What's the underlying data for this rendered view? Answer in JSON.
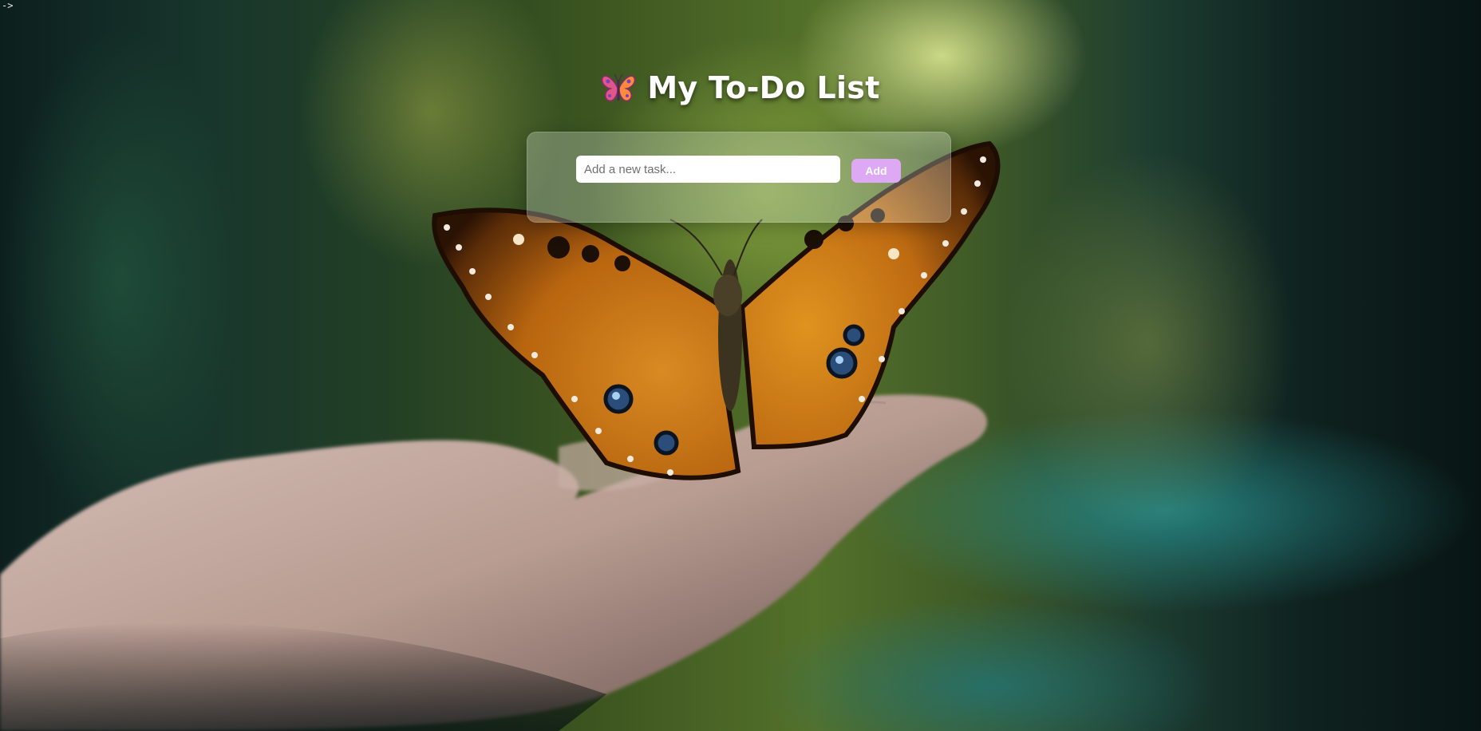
{
  "corner_marker": "->",
  "header": {
    "icon": "butterfly-icon",
    "title": "My To-Do List"
  },
  "task_form": {
    "input_value": "",
    "input_placeholder": "Add a new task...",
    "add_label": "Add"
  },
  "background": {
    "subject": "butterfly-on-hand-photo"
  },
  "colors": {
    "add_button": "#dda8f4",
    "title_text": "#ffffff",
    "card": "rgba(225,235,225,0.30)"
  }
}
